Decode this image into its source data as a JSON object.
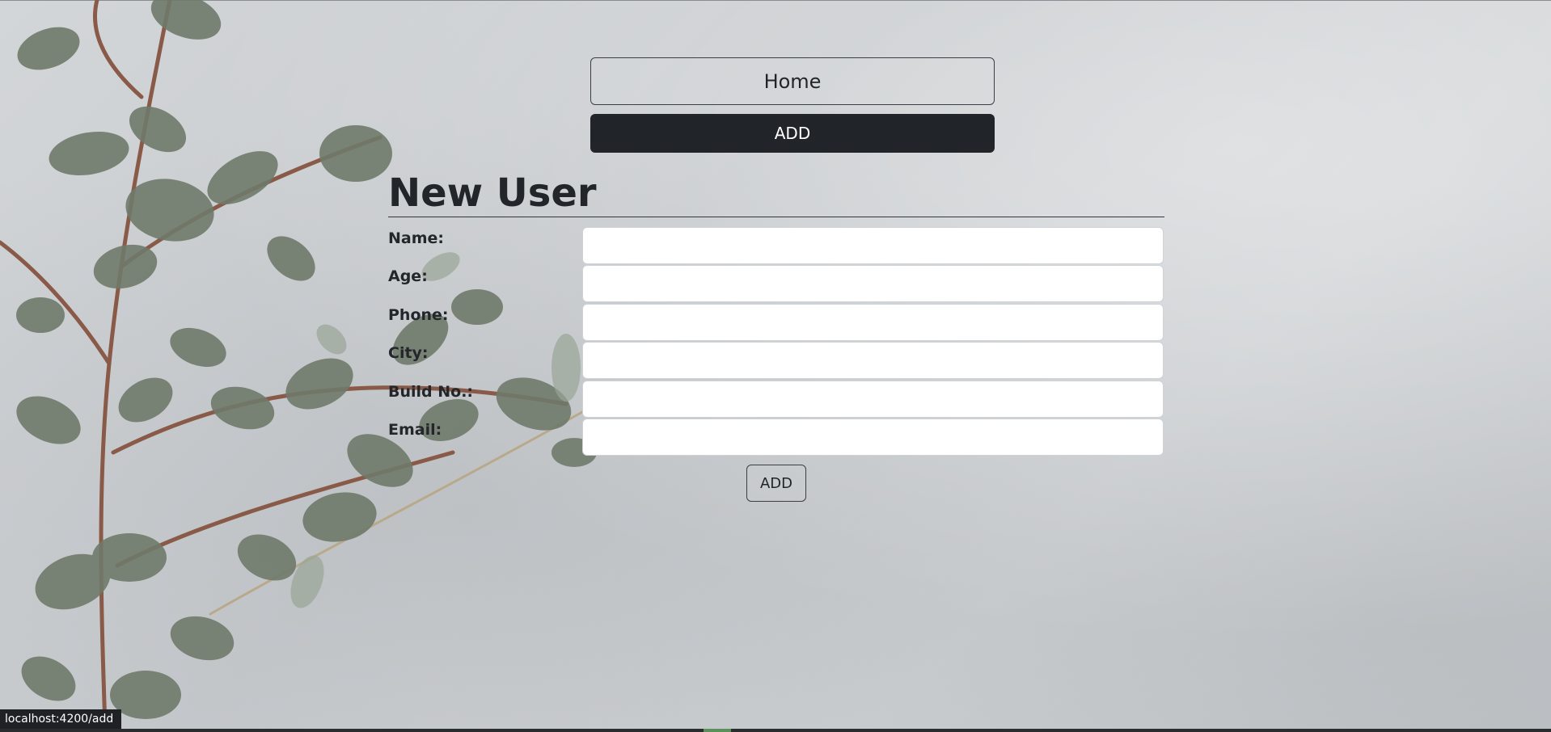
{
  "nav": {
    "home_label": "Home",
    "add_label": "ADD"
  },
  "form": {
    "title": "New User",
    "fields": [
      {
        "label": "Name:",
        "value": ""
      },
      {
        "label": "Age:",
        "value": ""
      },
      {
        "label": "Phone:",
        "value": ""
      },
      {
        "label": "City:",
        "value": ""
      },
      {
        "label": "Build No.:",
        "value": ""
      },
      {
        "label": "Email:",
        "value": ""
      }
    ],
    "submit_label": "ADD"
  },
  "status_bar": {
    "url": "localhost:4200/add"
  },
  "colors": {
    "dark_button": "#212529",
    "text": "#212529",
    "input_bg": "#ffffff"
  },
  "icons": {
    "background": "eucalyptus-branch-image"
  }
}
